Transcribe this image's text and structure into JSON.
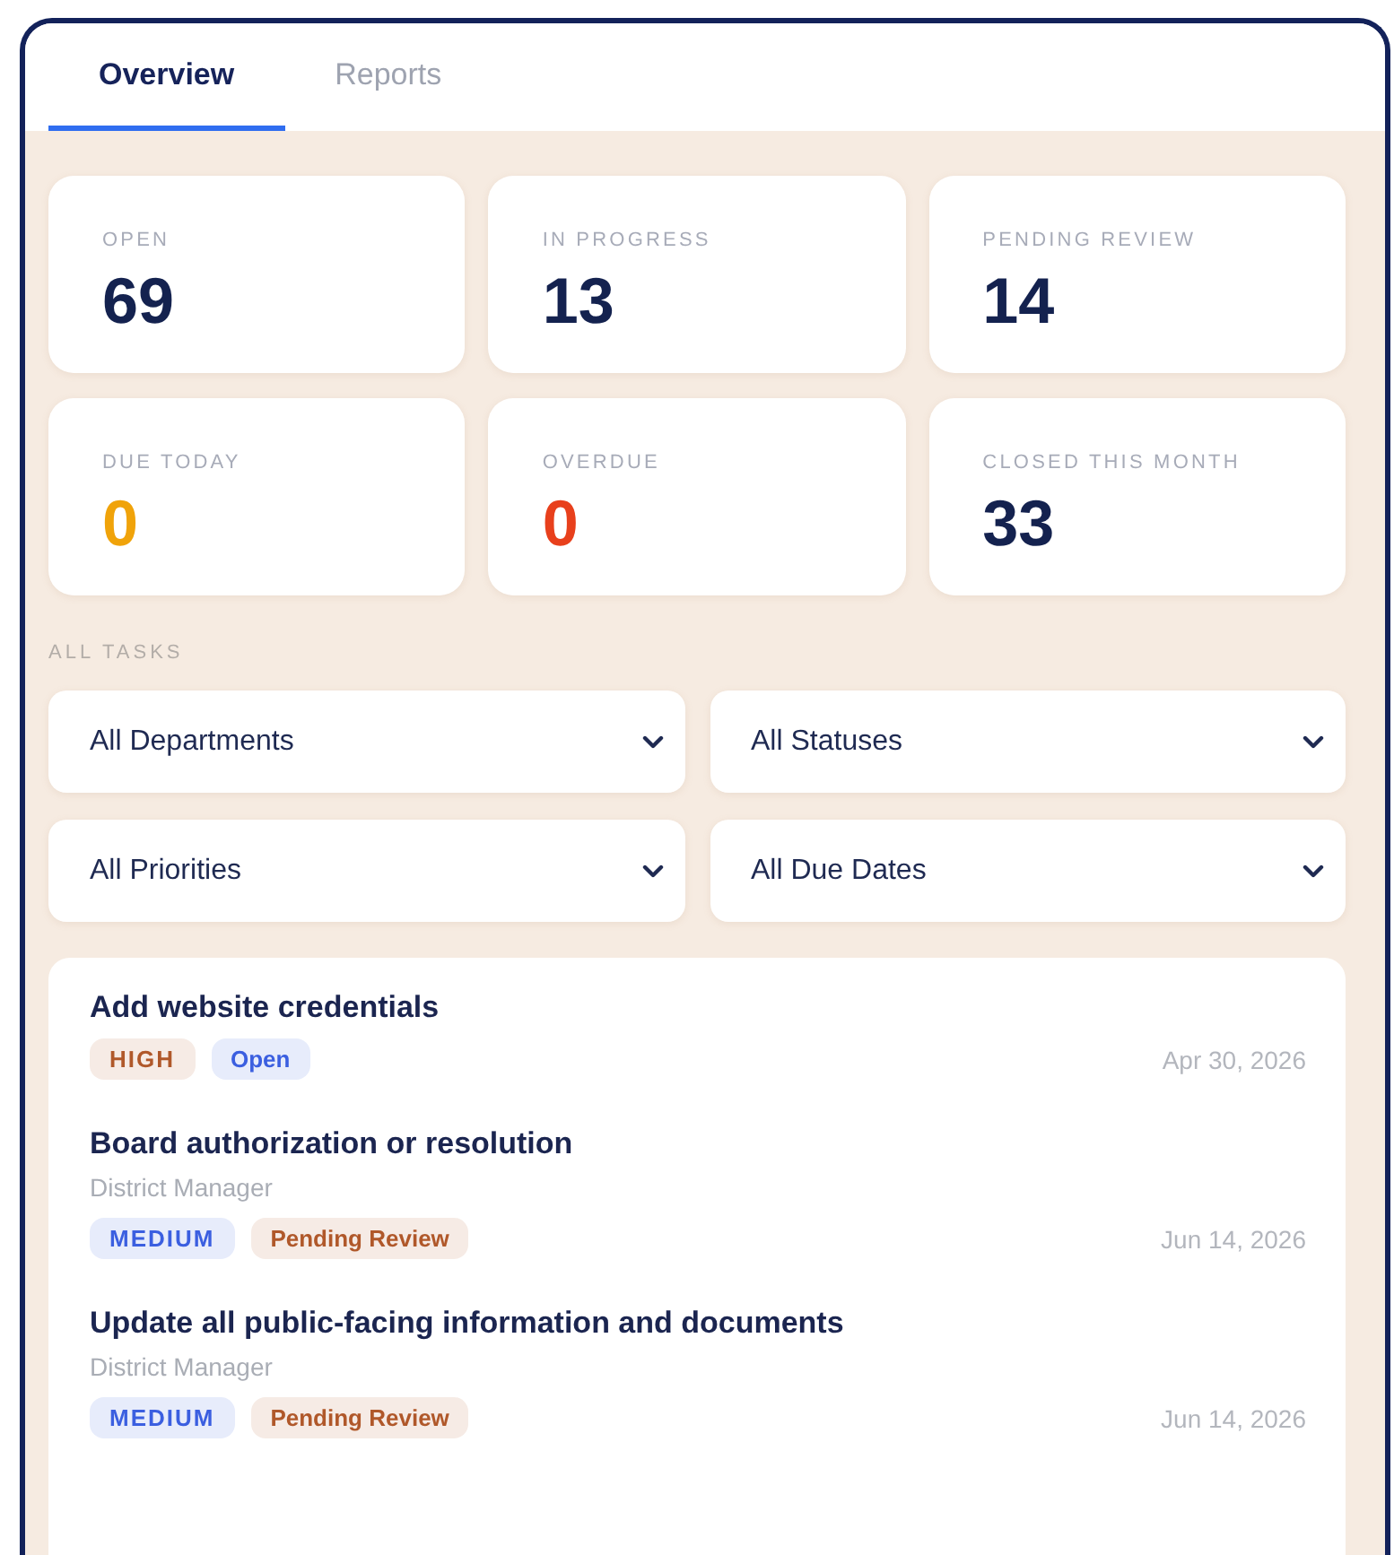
{
  "tabs": [
    {
      "label": "Overview",
      "selected": true
    },
    {
      "label": "Reports",
      "selected": false
    }
  ],
  "stats": [
    {
      "label": "OPEN",
      "value": "69",
      "color": "#14224f"
    },
    {
      "label": "IN PROGRESS",
      "value": "13",
      "color": "#14224f"
    },
    {
      "label": "PENDING REVIEW",
      "value": "14",
      "color": "#14224f"
    },
    {
      "label": "DUE TODAY",
      "value": "0",
      "color": "#f0a30a"
    },
    {
      "label": "OVERDUE",
      "value": "0",
      "color": "#e8401c"
    },
    {
      "label": "CLOSED THIS MONTH",
      "value": "33",
      "color": "#14224f"
    }
  ],
  "section_title": "ALL TASKS",
  "filters": [
    {
      "value": "All Departments"
    },
    {
      "value": "All Statuses"
    },
    {
      "value": "All Priorities"
    },
    {
      "value": "All Due Dates"
    }
  ],
  "tasks": [
    {
      "title": "Add website credentials",
      "priority": {
        "text": "HIGH",
        "color": "#b0582a"
      },
      "status": {
        "text": "Open",
        "color": "#3b5fe0"
      },
      "due": "Apr 30, 2026"
    },
    {
      "title": "Board authorization or resolution",
      "department": "District Manager",
      "priority": {
        "text": "MEDIUM",
        "color": "#3b5fe0"
      },
      "status": {
        "text": "Pending Review",
        "color": "#b0582a"
      },
      "due": "Jun 14, 2026"
    },
    {
      "title": "Update all public-facing information and documents",
      "department": "District Manager",
      "priority": {
        "text": "MEDIUM",
        "color": "#3b5fe0"
      },
      "status": {
        "text": "Pending Review",
        "color": "#b0582a"
      },
      "due": "Jun 14, 2026"
    }
  ]
}
